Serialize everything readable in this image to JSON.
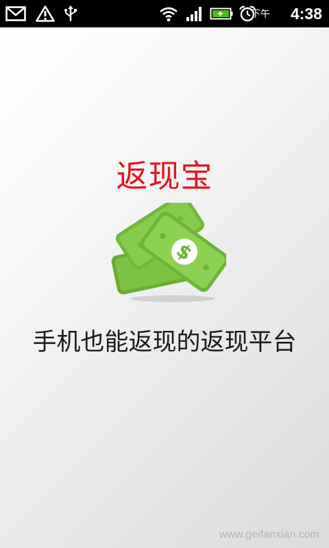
{
  "status_bar": {
    "icons": [
      "gmail-icon",
      "warning-icon",
      "usb-icon",
      "wifi-icon",
      "signal-icon",
      "battery-icon",
      "alarm-icon"
    ],
    "ampm": "下午",
    "time": "4:38"
  },
  "splash": {
    "title": "返现宝",
    "tagline": "手机也能返现的返现平台",
    "logo_symbol": "$",
    "title_color": "#e8141b",
    "accent_color": "#7cc242"
  },
  "watermark": "www.geifanxian.com"
}
